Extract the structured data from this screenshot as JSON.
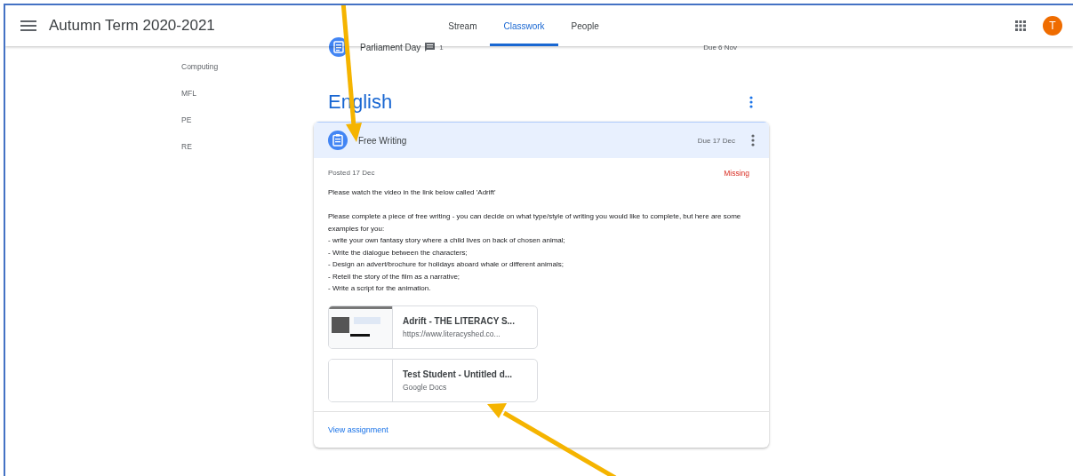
{
  "header": {
    "title": "Autumn Term 2020-2021",
    "avatar_letter": "T"
  },
  "tabs": [
    {
      "label": "Stream",
      "selected": false
    },
    {
      "label": "Classwork",
      "selected": true
    },
    {
      "label": "People",
      "selected": false
    }
  ],
  "sidebar": {
    "items": [
      "Computing",
      "MFL",
      "PE",
      "RE"
    ]
  },
  "previous_item": {
    "title": "Parliament Day",
    "comment_count": "1",
    "due": "Due 6 Nov"
  },
  "topic": {
    "title": "English"
  },
  "assignment": {
    "title": "Free Writing",
    "due": "Due 17 Dec",
    "posted": "Posted 17 Dec",
    "status": "Missing",
    "description": [
      [
        "Please watch the video in the link below called 'Adrift'"
      ],
      [
        "Please complete a piece of free writing - you can decide on what type/style of writing you would like to complete, but here are some examples for you:",
        "- write your own fantasy story where a child lives on back of chosen animal;",
        "- Write the dialogue between the characters;",
        "- Design an advert/brochure for holidays aboard whale or different animals;",
        "- Retell the story of the film as a narrative;",
        "- Write a script for the animation."
      ]
    ],
    "attachments": [
      {
        "kind": "link",
        "title": "Adrift - THE LITERACY S...",
        "subtitle": "https://www.literacyshed.co..."
      },
      {
        "kind": "doc",
        "title": "Test Student - Untitled d...",
        "subtitle": "Google Docs"
      }
    ],
    "view_link": "View assignment"
  }
}
